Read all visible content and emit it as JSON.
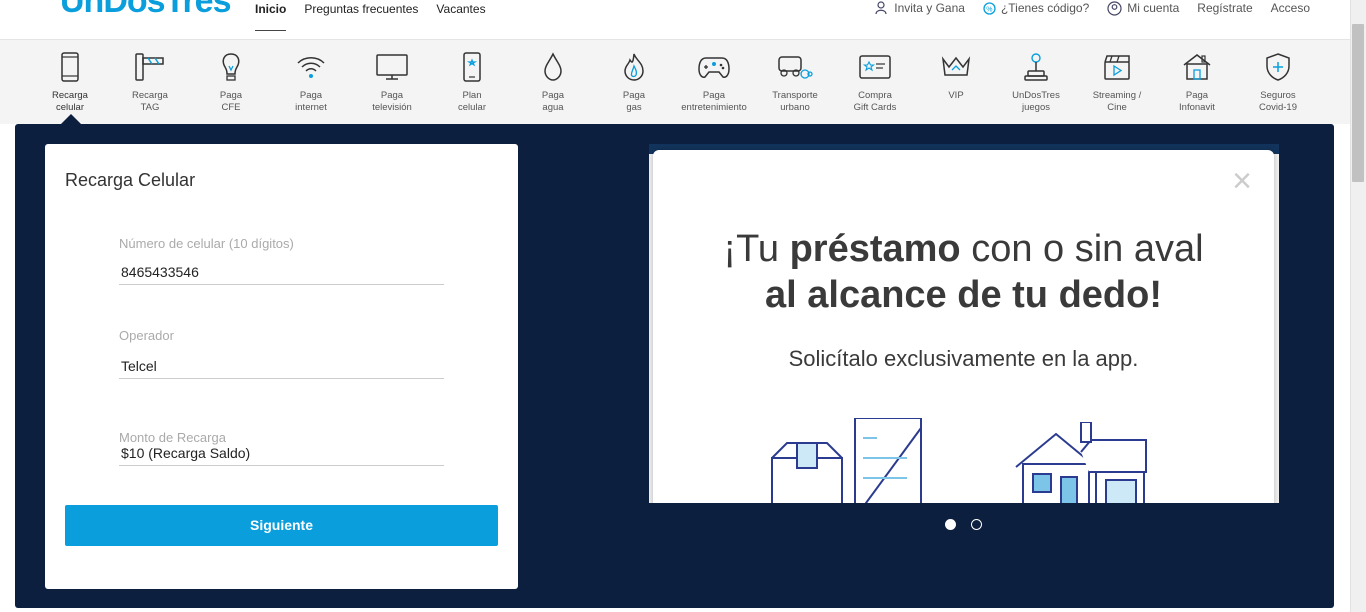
{
  "header": {
    "logo": {
      "part1": "Un",
      "part2": "Dos",
      "part3": "Tres"
    },
    "nav": [
      {
        "label": "Inicio",
        "active": true
      },
      {
        "label": "Preguntas frecuentes",
        "active": false
      },
      {
        "label": "Vacantes",
        "active": false
      }
    ],
    "right": [
      {
        "label": "Invita y Gana",
        "icon": "invite-icon"
      },
      {
        "label": "¿Tienes código?",
        "icon": "code-icon"
      },
      {
        "label": "Mi cuenta",
        "icon": "user-icon"
      },
      {
        "label": "Regístrate",
        "icon": ""
      },
      {
        "label": "Acceso",
        "icon": ""
      }
    ]
  },
  "services": [
    {
      "label": "Recarga\ncelular",
      "icon": "phone-icon",
      "active": true
    },
    {
      "label": "Recarga\nTAG",
      "icon": "toll-tag-icon"
    },
    {
      "label": "Paga\nCFE",
      "icon": "bulb-icon"
    },
    {
      "label": "Paga\ninternet",
      "icon": "wifi-icon"
    },
    {
      "label": "Paga\ntelevisión",
      "icon": "tv-icon"
    },
    {
      "label": "Plan\ncelular",
      "icon": "phone-plan-icon"
    },
    {
      "label": "Paga\nagua",
      "icon": "water-drop-icon"
    },
    {
      "label": "Paga\ngas",
      "icon": "flame-icon"
    },
    {
      "label": "Paga\nentretenimiento",
      "icon": "gamepad-icon"
    },
    {
      "label": "Transporte\nurbano",
      "icon": "transport-icon"
    },
    {
      "label": "Compra\nGift Cards",
      "icon": "gift-card-icon"
    },
    {
      "label": "VIP",
      "icon": "crown-icon"
    },
    {
      "label": "UnDosTres\njuegos",
      "icon": "joystick-icon"
    },
    {
      "label": "Streaming /\nCine",
      "icon": "clapper-icon"
    },
    {
      "label": "Paga\nInfonavit",
      "icon": "house-icon"
    },
    {
      "label": "Seguros\nCovid-19",
      "icon": "shield-icon"
    }
  ],
  "form": {
    "title": "Recarga Celular",
    "phone_label": "Número de celular (10 dígitos)",
    "phone_value": "8465433546",
    "operator_label": "Operador",
    "operator_value": "Telcel",
    "amount_label": "Monto de Recarga",
    "amount_value": "$10 (Recarga Saldo)",
    "submit_label": "Siguiente"
  },
  "banner": {
    "line1_pre": "¡Tu ",
    "line1_bold": "préstamo",
    "line1_post": " con o sin aval",
    "line2": "al alcance de tu dedo!",
    "subtitle": "Solicítalo exclusivamente en la app.",
    "close": "×",
    "slides": 2,
    "active_slide": 1
  },
  "colors": {
    "accent": "#0a9fdc",
    "panel": "#0d1f3f",
    "strip": "#f4f4f4"
  }
}
